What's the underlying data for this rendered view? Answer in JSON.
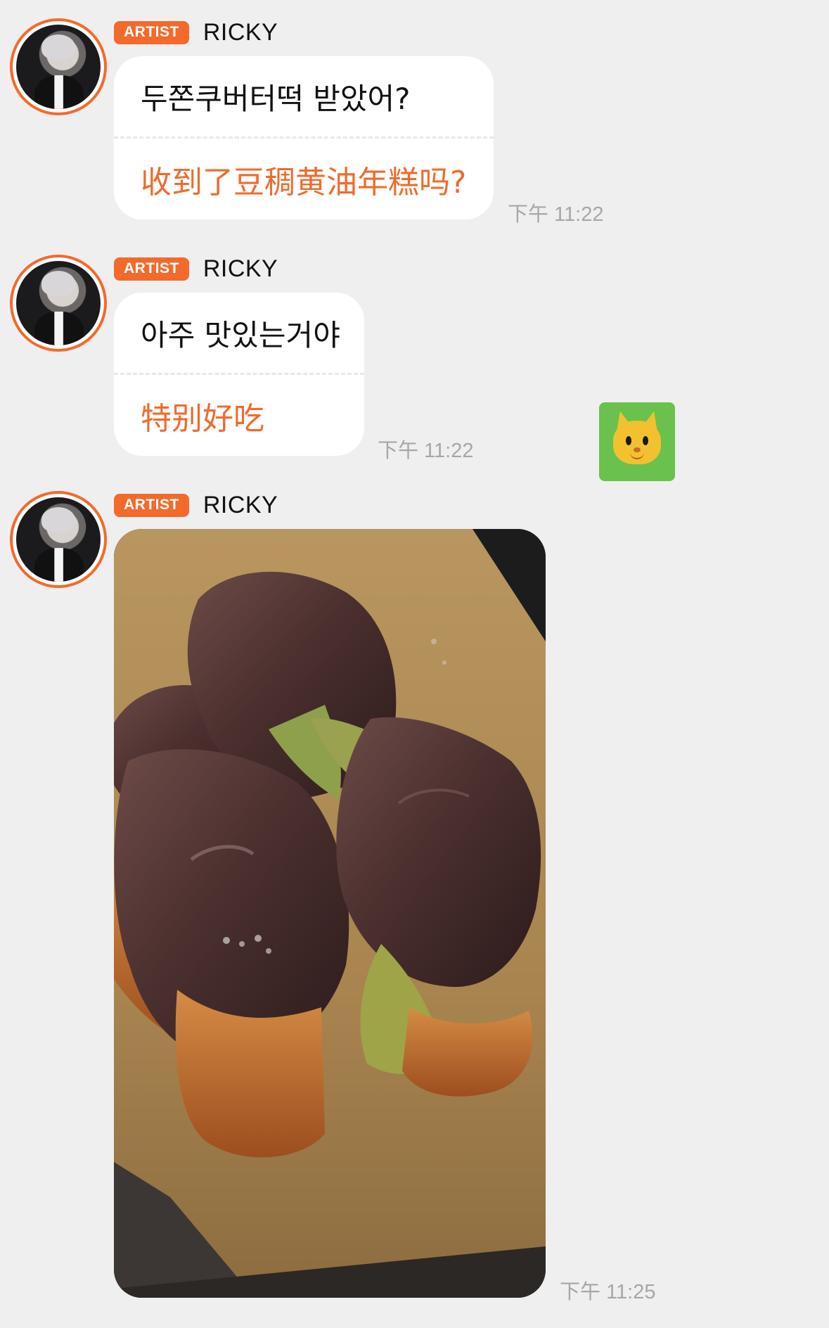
{
  "messages": [
    {
      "badge": "ARTIST",
      "sender": "RICKY",
      "text": "두쫀쿠버터떡 받았어?",
      "translation": "收到了豆稠黄油年糕吗?",
      "time": "下午 11:22"
    },
    {
      "badge": "ARTIST",
      "sender": "RICKY",
      "text": "아주 맛있는거야",
      "translation": "特别好吃",
      "time": "下午 11:22"
    },
    {
      "badge": "ARTIST",
      "sender": "RICKY",
      "time": "下午 11:25"
    }
  ],
  "icons": {
    "avatar": "artist-avatar",
    "sticker": "cat-face-icon"
  },
  "colors": {
    "background": "#efefef",
    "accent": "#f36a2b",
    "translation_text": "#ef6b2c",
    "timestamp": "#a7a7a7",
    "sticker_background": "#6ac14d"
  }
}
